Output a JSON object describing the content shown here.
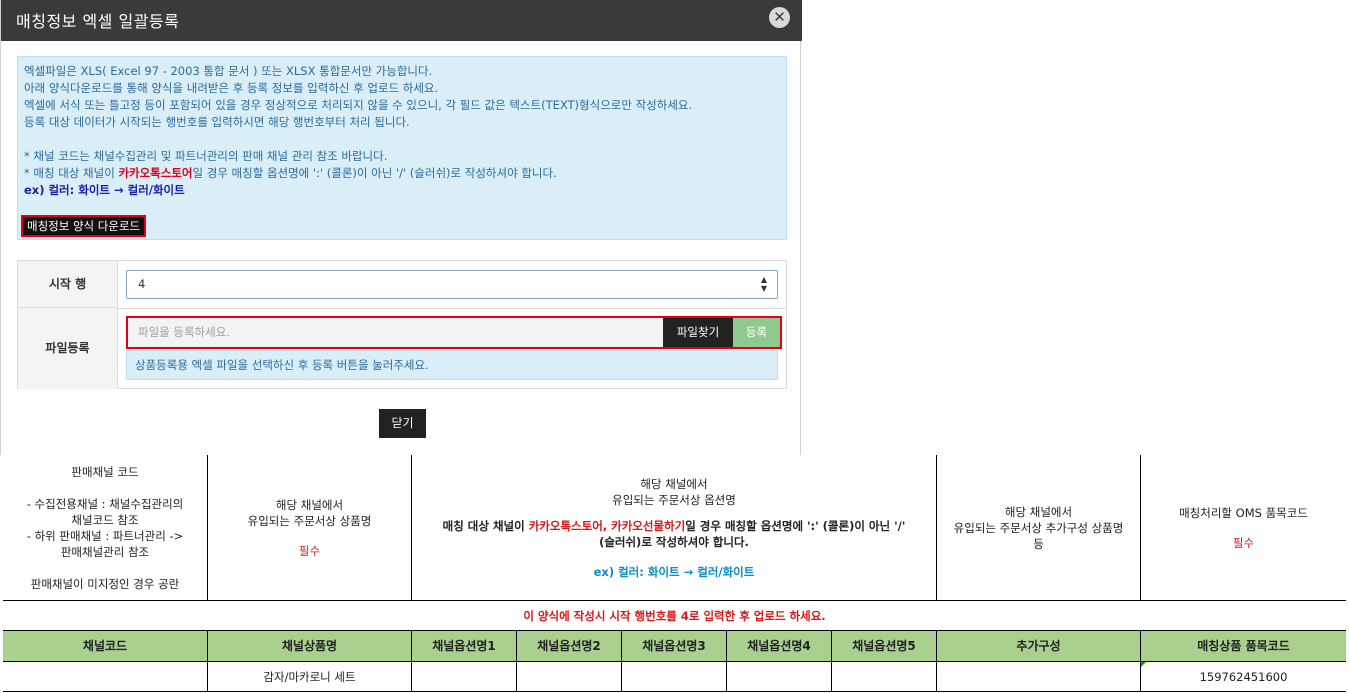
{
  "modal": {
    "title": "매칭정보 엑셀 일괄등록",
    "close_glyph": "✕",
    "notice": {
      "lines": [
        "엑셀파일은 XLS( Excel 97 - 2003 통합 문서 ) 또는 XLSX 통합문서만 가능합니다.",
        "아래 양식다운로드를 통해 양식을 내려받은 후 등록 정보를 입력하신 후 업로드 하세요.",
        "엑셀에 서식 또는 틀고정 등이 포함되어 있을 경우 정상적으로 처리되지 않을 수 있으니, 각 필드 값은 텍스트(TEXT)형식으로만 작성하세요.",
        "등록 대상 데이터가 시작되는 행번호를 입력하시면 해당 행번호부터 처리 됩니다."
      ],
      "note1": "* 채널 코드는 채널수집관리 및 파트너관리의 판매 채널 관리 참조 바랍니다.",
      "note2_prefix": "* 매칭 대상 채널이 ",
      "note2_highlight": "카카오톡스토어",
      "note2_suffix": "일 경우 매칭할 옵션명에 ':' (콜론)이 아닌 '/' (슬러쉬)로 작성하셔야 합니다.",
      "example": "ex) 컬러: 화이트 → 컬러/화이트",
      "download_button": "매칭정보 양식 다운로드"
    },
    "form": {
      "start_row_label": "시작 행",
      "start_row_value": "4",
      "file_label": "파일등록",
      "file_placeholder": "파일을 등록하세요.",
      "find_button": "파일찾기",
      "register_button": "등록",
      "file_help": "상품등록용 엑셀 파일을 선택하신 후 등록 버튼을 눌러주세요."
    },
    "close_button": "닫기"
  },
  "sheet": {
    "desc": {
      "channel_code": [
        "판매채널 코드",
        "",
        "- 수집전용채널 : 채널수집관리의",
        "채널코드 참조",
        "- 하위 판매채널 : 파트너관리 ->",
        "판매채널관리 참조",
        "",
        "판매채널이 미지정인 경우 공란"
      ],
      "product_name": [
        "해당 채널에서",
        "유입되는 주문서상 상품명"
      ],
      "product_required": "필수",
      "option_name": [
        "해당 채널에서",
        "유입되는 주문서상 옵션명"
      ],
      "option_rule_prefix": "매칭 대상 채널이 ",
      "option_rule_channels": "카카오톡스토어, 카카오선물하기",
      "option_rule_suffix": "일 경우 매칭할 옵션명에 ':' (콜론)이 아닌 '/'",
      "option_rule_line2": "(슬러쉬)로 작성하셔야 합니다.",
      "option_example": "ex) 컬러: 화이트 → 컬러/화이트",
      "addon_name": [
        "해당 채널에서",
        "유입되는 주문서상 추가구성 상품명",
        "등"
      ],
      "oms_code": "매칭처리할 OMS 품목코드",
      "oms_required": "필수"
    },
    "instruction": "이 양식에 작성시 시작 행번호를 4로 입력한 후 업로드 하세요.",
    "headers": [
      "채널코드",
      "채널상품명",
      "채널옵션명1",
      "채널옵션명2",
      "채널옵션명3",
      "채널옵션명4",
      "채널옵션명5",
      "추가구성",
      "매칭상품 품목코드"
    ],
    "rows": [
      [
        "",
        "감자/마카로니 세트",
        "",
        "",
        "",
        "",
        "",
        "",
        "159762451600"
      ]
    ]
  }
}
